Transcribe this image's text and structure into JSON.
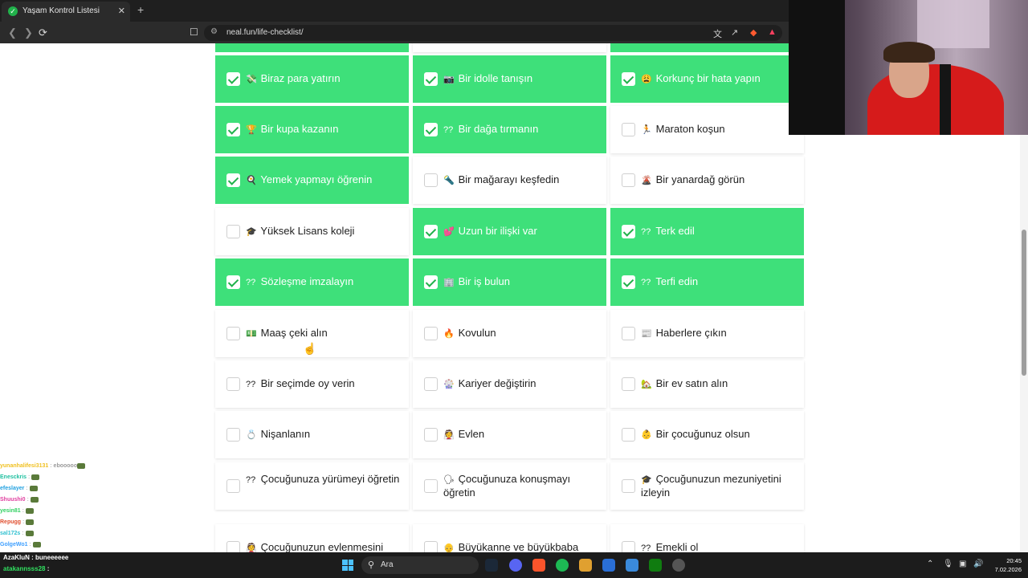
{
  "browser": {
    "tab_title": "Yaşam Kontrol Listesi",
    "url": "neal.fun/life-checklist/",
    "new_tab": "+",
    "close": "✕"
  },
  "cards": [
    {
      "emoji": "💸",
      "label": "Biraz para yatırın",
      "checked": true
    },
    {
      "emoji": "📷",
      "label": "Bir idolle tanışın",
      "checked": true
    },
    {
      "emoji": "😩",
      "label": "Korkunç bir hata yapın",
      "checked": true
    },
    {
      "emoji": "🏆",
      "label": "Bir kupa kazanın",
      "checked": true
    },
    {
      "emoji": "??",
      "label": "Bir dağa tırmanın",
      "checked": true
    },
    {
      "emoji": "🏃",
      "label": "Maraton koşun",
      "checked": false
    },
    {
      "emoji": "🍳",
      "label": "Yemek yapmayı öğrenin",
      "checked": true
    },
    {
      "emoji": "🔦",
      "label": "Bir mağarayı keşfedin",
      "checked": false
    },
    {
      "emoji": "🌋",
      "label": "Bir yanardağ görün",
      "checked": false
    },
    {
      "emoji": "🎓",
      "label": "Yüksek Lisans koleji",
      "checked": false
    },
    {
      "emoji": "💕",
      "label": "Uzun bir ilişki var",
      "checked": true
    },
    {
      "emoji": "??",
      "label": "Terk edil",
      "checked": true
    },
    {
      "emoji": "??",
      "label": "Sözleşme imzalayın",
      "checked": true
    },
    {
      "emoji": "🏢",
      "label": "Bir iş bulun",
      "checked": true
    },
    {
      "emoji": "??",
      "label": "Terfi edin",
      "checked": true
    },
    {
      "emoji": "💵",
      "label": "Maaş çeki alın",
      "checked": false
    },
    {
      "emoji": "🔥",
      "label": "Kovulun",
      "checked": false
    },
    {
      "emoji": "📰",
      "label": "Haberlere çıkın",
      "checked": false
    },
    {
      "emoji": "??",
      "label": "Bir seçimde oy verin",
      "checked": false
    },
    {
      "emoji": "🎡",
      "label": "Kariyer değiştirin",
      "checked": false
    },
    {
      "emoji": "🏡",
      "label": "Bir ev satın alın",
      "checked": false
    },
    {
      "emoji": "💍",
      "label": "Nişanlanın",
      "checked": false
    },
    {
      "emoji": "👰",
      "label": "Evlen",
      "checked": false
    },
    {
      "emoji": "👶",
      "label": "Bir çocuğunuz olsun",
      "checked": false
    },
    {
      "emoji": "??",
      "label": "Çocuğunuza yürümeyi öğretin",
      "checked": false
    },
    {
      "emoji": "🗣",
      "label": "Çocuğunuza konuşmayı öğretin",
      "checked": false
    },
    {
      "emoji": "🎓",
      "label": "Çocuğunuzun mezuniyetini izleyin",
      "checked": false
    },
    {
      "emoji": "👰",
      "label": "Çocuğunuzun evlenmesini",
      "checked": false
    },
    {
      "emoji": "👴",
      "label": "Büyükanne ve büyükbaba",
      "checked": false
    },
    {
      "emoji": "??",
      "label": "Emekli ol",
      "checked": false
    }
  ],
  "chat": [
    {
      "user": "yunanhalifesi3131",
      "msg": "ebooooo",
      "color": "#f0c020"
    },
    {
      "user": "Enesckris",
      "msg": "",
      "color": "#20c0a0"
    },
    {
      "user": "efeslayer",
      "msg": "",
      "color": "#20a0e0"
    },
    {
      "user": "Shuushi0",
      "msg": "",
      "color": "#e040a0"
    },
    {
      "user": "yesin81",
      "msg": "",
      "color": "#30d060"
    },
    {
      "user": "Repugg",
      "msg": "",
      "color": "#e05030"
    },
    {
      "user": "sal172s",
      "msg": "",
      "color": "#30c0d0"
    },
    {
      "user": "GolgeWo1",
      "msg": "",
      "color": "#40a0ff"
    }
  ],
  "taskbar_chat": [
    {
      "user": "AzaKluN",
      "msg": "buneeeeee",
      "color": "#ffffff"
    },
    {
      "user": "atakannsss28",
      "msg": "",
      "color": "#30e060"
    }
  ],
  "taskbar": {
    "search_placeholder": "Ara",
    "time": "20:45",
    "date": "7.02.2026"
  }
}
